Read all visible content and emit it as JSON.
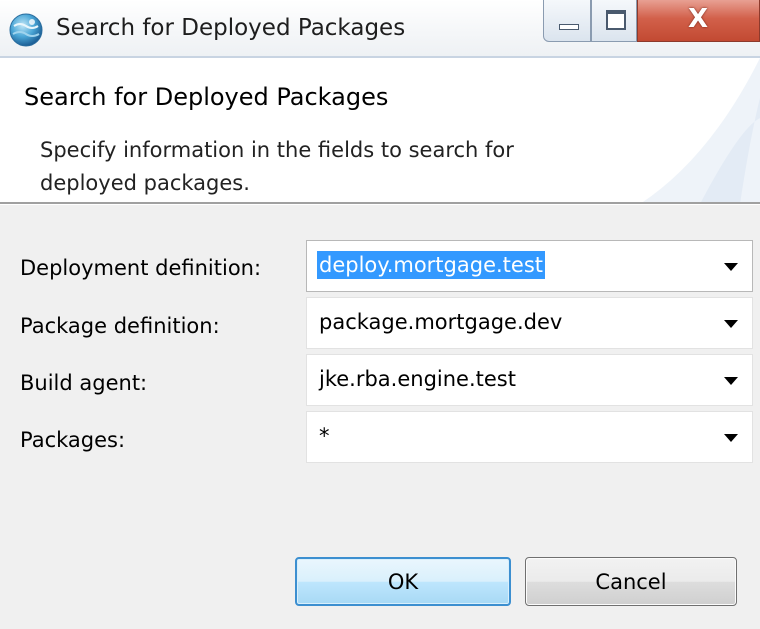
{
  "window": {
    "title": "Search for Deployed Packages",
    "controls": {
      "minimize": "minimize-icon",
      "maximize": "maximize-icon",
      "close": "close-icon"
    }
  },
  "header": {
    "title": "Search for Deployed Packages",
    "description": "Specify information in the fields to search for deployed packages."
  },
  "form": {
    "fields": [
      {
        "label": "Deployment definition:",
        "value": "deploy.mortgage.test",
        "selected": true
      },
      {
        "label": "Package definition:",
        "value": "package.mortgage.dev",
        "selected": false
      },
      {
        "label": "Build agent:",
        "value": "jke.rba.engine.test",
        "selected": false
      },
      {
        "label": "Packages:",
        "value": "*",
        "selected": false
      }
    ]
  },
  "buttons": {
    "ok": "OK",
    "cancel": "Cancel"
  },
  "colors": {
    "selection": "#3399ff",
    "ok_border": "#3c8fd0",
    "close_button": "#c24a32"
  }
}
